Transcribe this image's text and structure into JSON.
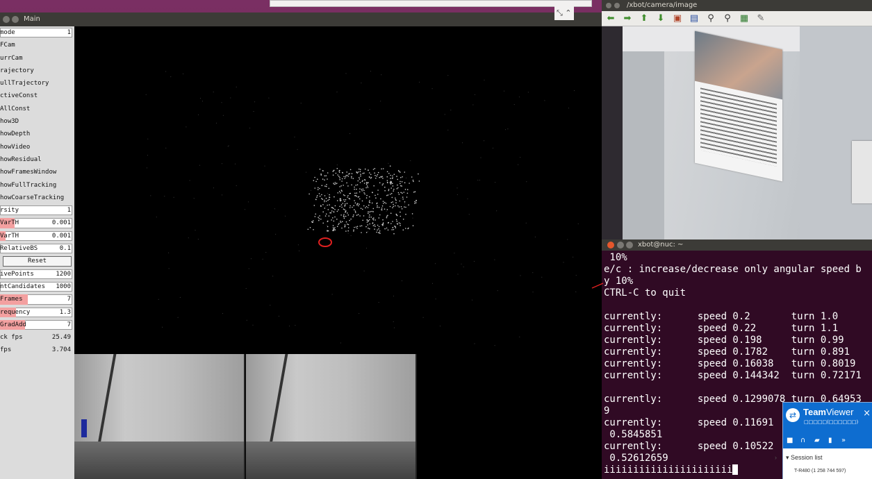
{
  "main_window": {
    "title": "Main",
    "panel": [
      {
        "label": "mode",
        "value": "1",
        "kind": "field"
      },
      {
        "label": "FCam",
        "kind": "check"
      },
      {
        "label": "urrCam",
        "kind": "check"
      },
      {
        "label": "rajectory",
        "kind": "check"
      },
      {
        "label": "ullTrajectory",
        "kind": "check"
      },
      {
        "label": "ctiveConst",
        "kind": "check"
      },
      {
        "label": "AllConst",
        "kind": "check"
      },
      {
        "label": "how3D",
        "kind": "check"
      },
      {
        "label": "howDepth",
        "kind": "check"
      },
      {
        "label": "howVideo",
        "kind": "check"
      },
      {
        "label": "howResidual",
        "kind": "check"
      },
      {
        "label": "howFramesWindow",
        "kind": "check"
      },
      {
        "label": "howFullTracking",
        "kind": "check"
      },
      {
        "label": "howCoarseTracking",
        "kind": "check"
      },
      {
        "label": "rsity",
        "value": "1",
        "kind": "field"
      },
      {
        "label": "VarTH",
        "value": "0.001",
        "kind": "slider",
        "fill": 0.2
      },
      {
        "label": "VarTH",
        "value": "0.001",
        "kind": "slider",
        "fill": 0.08
      },
      {
        "label": "RelativeBS",
        "value": "0.1",
        "kind": "field"
      },
      {
        "label": "Reset",
        "kind": "button"
      },
      {
        "label": "ivePoints",
        "value": "1200",
        "kind": "field"
      },
      {
        "label": "ntCandidates",
        "value": "1000",
        "kind": "field"
      },
      {
        "label": "Frames",
        "value": "7",
        "kind": "slider",
        "fill": 0.38
      },
      {
        "label": "requency",
        "value": "1.3",
        "kind": "slider",
        "fill": 0.22
      },
      {
        "label": "GradAdd",
        "value": "7",
        "kind": "slider",
        "fill": 0.35
      },
      {
        "label": "ck fps",
        "value": "25.49",
        "kind": "text"
      },
      {
        "label": "fps",
        "value": "3.704",
        "kind": "text"
      }
    ]
  },
  "image_window": {
    "title": "/xbot/camera/image",
    "tools": [
      "arrow-left-icon",
      "arrow-right-icon",
      "arrow-up-icon",
      "arrow-down-icon",
      "image-icon",
      "image-save-icon",
      "zoom-in-icon",
      "zoom-out-icon",
      "save-icon",
      "settings-icon"
    ]
  },
  "terminal": {
    "title": "xbot@nuc: ~",
    "lines": [
      " 10%",
      "e/c : increase/decrease only angular speed b",
      "y 10%",
      "CTRL-C to quit",
      "",
      "currently:      speed 0.2       turn 1.0",
      "currently:      speed 0.22      turn 1.1",
      "currently:      speed 0.198     turn 0.99",
      "currently:      speed 0.1782    turn 0.891",
      "currently:      speed 0.16038   turn 0.8019",
      "currently:      speed 0.144342  turn 0.72171",
      "",
      "currently:      speed 0.1299078 turn 0.64953",
      "9",
      "currently:      speed 0.11691",
      " 0.5845851",
      "currently:      speed 0.10522",
      " 0.52612659"
    ],
    "input": "iiiiiiiiiiiiiiiiiiiiii"
  },
  "teamviewer": {
    "brand_bold": "Team",
    "brand": "Viewer",
    "subtitle": "□□□□□(□□□□□□)",
    "close": "×",
    "session_list": "Session list",
    "session_item": "T-R480 (1 258 744 597)",
    "accent": "#0e6dd0"
  }
}
